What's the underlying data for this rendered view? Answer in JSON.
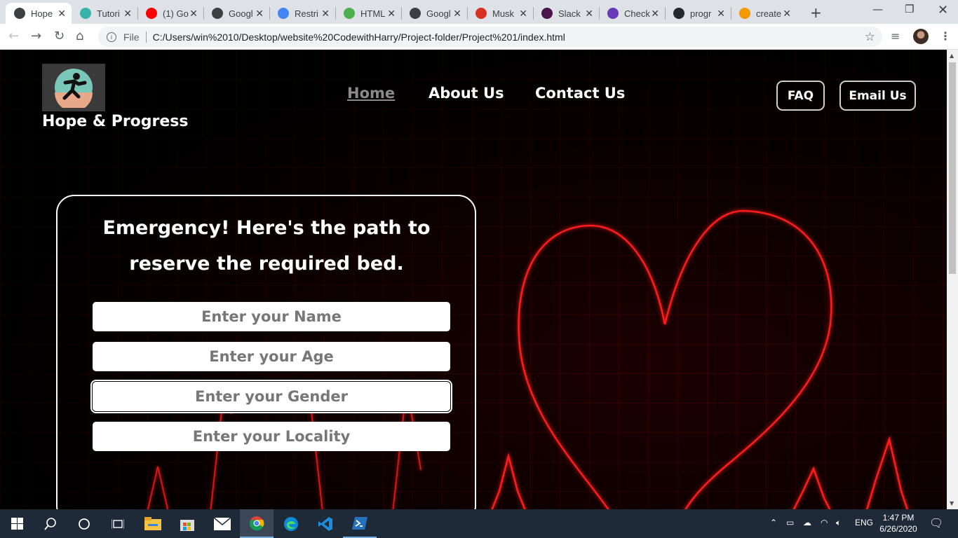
{
  "browser": {
    "tabs": [
      {
        "title": "Hope",
        "icon": "globe-icon",
        "color": "#3c4043",
        "active": true
      },
      {
        "title": "Tutori",
        "icon": "code-icon",
        "color": "#38b2ac"
      },
      {
        "title": "(1) Go",
        "icon": "youtube-icon",
        "color": "#ff0000"
      },
      {
        "title": "Googl",
        "icon": "globe-icon",
        "color": "#3c4043"
      },
      {
        "title": "Restri",
        "icon": "google-icon",
        "color": "#4285f4"
      },
      {
        "title": "HTML",
        "icon": "w3schools-icon",
        "color": "#4caf50"
      },
      {
        "title": "Googl",
        "icon": "globe-icon",
        "color": "#3c4043"
      },
      {
        "title": "Musk",
        "icon": "gmail-icon",
        "color": "#d93025"
      },
      {
        "title": "Slack",
        "icon": "slack-icon",
        "color": "#4a154b"
      },
      {
        "title": "Check",
        "icon": "forms-icon",
        "color": "#673ab7"
      },
      {
        "title": "progr",
        "icon": "github-icon",
        "color": "#24292e"
      },
      {
        "title": "create",
        "icon": "spark-icon",
        "color": "#f29900"
      }
    ],
    "omnibox": {
      "scheme": "File",
      "url": "C:/Users/win%2010/Desktop/website%20CodewithHarry/Project-folder/Project%201/index.html"
    }
  },
  "site": {
    "brand": "Hope & Progress",
    "nav": {
      "home": "Home",
      "about": "About Us",
      "contact": "Contact Us"
    },
    "buttons": {
      "faq": "FAQ",
      "email": "Email Us"
    },
    "form": {
      "title": "Emergency! Here's the path to reserve the required bed.",
      "name_placeholder": "Enter your Name",
      "age_placeholder": "Enter your Age",
      "gender_placeholder": "Enter your Gender",
      "locality_placeholder": "Enter your Locality"
    },
    "colors": {
      "accent_red": "#ff1a1a",
      "background": "#050000",
      "muted_nav": "#8a8a8a"
    }
  },
  "taskbar": {
    "apps": [
      "start-icon",
      "search-icon",
      "cortana-icon",
      "task-view-icon",
      "file-explorer-icon",
      "store-icon",
      "mail-icon",
      "chrome-icon",
      "edge-icon",
      "vscode-icon",
      "powershell-icon"
    ],
    "language": "ENG",
    "time": "1:47 PM",
    "date": "6/26/2020"
  }
}
